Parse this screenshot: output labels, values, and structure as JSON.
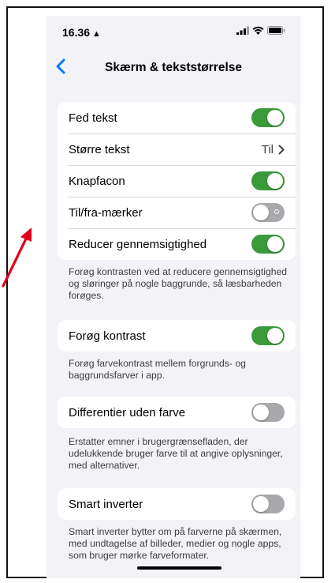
{
  "status_bar": {
    "time": "16.36",
    "person_icon": "person-icon",
    "signal_icon": "cellular-signal-icon",
    "wifi_icon": "wifi-icon",
    "battery_icon": "battery-icon"
  },
  "nav": {
    "back_icon": "chevron-left-icon",
    "title": "Skærm & tekststørrelse"
  },
  "colors": {
    "accent_blue": "#007aff",
    "toggle_on": "#3a9a3a",
    "toggle_off": "#a8a8ad",
    "background": "#f2f2f7",
    "annotation_arrow": "#e0001a"
  },
  "group1": {
    "rows": [
      {
        "label": "Fed tekst",
        "state": "on"
      },
      {
        "label": "Større tekst",
        "value": "Til"
      },
      {
        "label": "Knapfacon",
        "state": "on"
      },
      {
        "label": "Til/fra-mærker",
        "state": "off"
      },
      {
        "label": "Reducer gennemsigtighed",
        "state": "on"
      }
    ],
    "footer": "Forøg kontrasten ved at reducere gennemsigtighed og sløringer på nogle baggrunde, så læsbarheden forøges."
  },
  "group2": {
    "row": {
      "label": "Forøg kontrast",
      "state": "on"
    },
    "footer": "Forøg farvekontrast mellem forgrunds- og baggrundsfarver i app."
  },
  "group3": {
    "row": {
      "label": "Differentier uden farve",
      "state": "off"
    },
    "footer": "Erstatter emner i brugergrænsefladen, der udelukkende bruger farve til at angive oplysninger, med alternativer."
  },
  "group4": {
    "row": {
      "label": "Smart inverter",
      "state": "off"
    },
    "footer": "Smart inverter bytter om på farverne på skærmen, med undtagelse af billeder, medier og nogle apps, som bruger mørke farveformater."
  },
  "annotation": {
    "icon": "red-arrow-icon"
  }
}
